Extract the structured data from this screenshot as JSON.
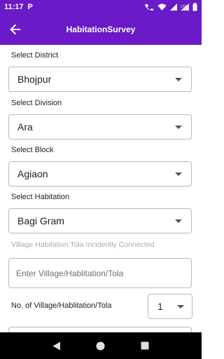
{
  "status_bar": {
    "time": "11:17",
    "app_indicator": "P",
    "icons": [
      "volte-icon",
      "wifi-icon",
      "signal-icon",
      "signal-lte-icon",
      "battery-icon"
    ]
  },
  "app_bar": {
    "title": "HabitationSurvey",
    "back_icon": "arrow-back-icon",
    "color": "#6a1ac7"
  },
  "form": {
    "district": {
      "label": "Select District",
      "value": "Bhojpur"
    },
    "division": {
      "label": "Select Division",
      "value": "Ara"
    },
    "block": {
      "label": "Select Block",
      "value": "Agiaon"
    },
    "habitation": {
      "label": "Select Habitation",
      "value": "Bagi Gram"
    },
    "connected_hint": "Village Habitation Tola Incidently Connected",
    "village_input": {
      "placeholder": "Enter Village/Hablitation/Tola",
      "value": ""
    },
    "count": {
      "label": "No. of Village/Hablitation/Tola",
      "value": "1"
    }
  },
  "nav_bar": {
    "icons": [
      "back-triangle-icon",
      "home-circle-icon",
      "recents-square-icon"
    ]
  }
}
